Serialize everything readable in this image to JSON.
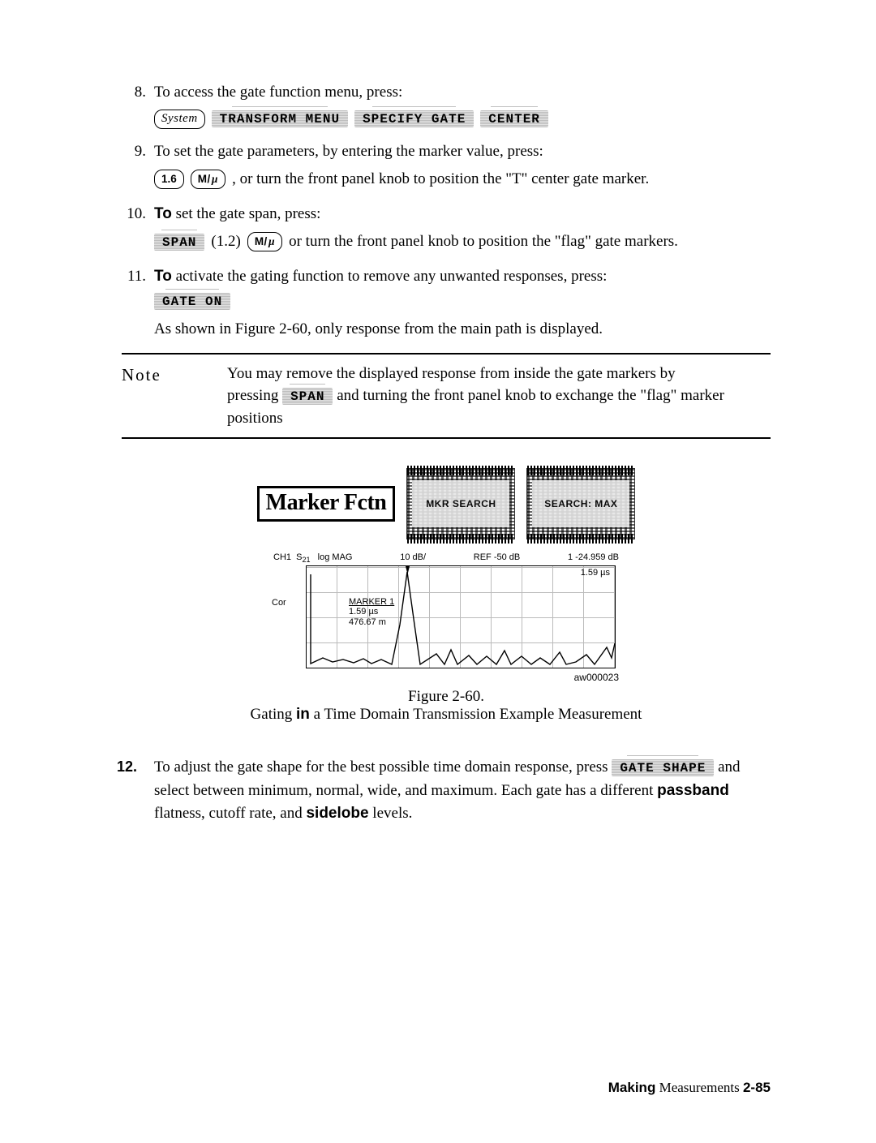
{
  "steps": {
    "s8": {
      "num": "8.",
      "text": "To   access the gate function menu, press:",
      "keys": {
        "system": "System",
        "transform": "TRANSFORM MENU",
        "specify": "SPECIFY GATE",
        "center": "CENTER"
      }
    },
    "s9": {
      "num": "9.",
      "text": "To set the gate parameters, by entering the marker value, press:",
      "val": "1.6",
      "unit": "M/µ",
      "tail_a": ", or turn the front panel knob to position the ",
      "tail_q1": "\"",
      "tail_t": "T",
      "tail_q2": "\"",
      "tail_b": " center gate marker."
    },
    "s10": {
      "num": "10.",
      "lead": "To",
      "text": " set the gate span, press:",
      "span": "SPAN",
      "val": "(1.2)",
      "unit": "M/µ",
      "tail": " or turn the front panel knob to position the \"flag\" gate markers."
    },
    "s11": {
      "num": "11.",
      "lead": "To",
      "text": " activate the gating function to remove any unwanted responses, press:",
      "gate_on": "GATE ON",
      "after": "As shown in Figure 2-60, only response from the main path is displayed."
    }
  },
  "note": {
    "label": "Note",
    "line1_a": "You may remove the displayed response from inside the gate markers by",
    "line2_a": "pressing ",
    "span": "SPAN",
    "line2_b": " and turning the front panel knob to exchange the \"flag\" marker",
    "line3": "positions"
  },
  "figure": {
    "marker_fctn": "Marker Fctn",
    "barcode_a": "MKR SEARCH",
    "barcode_b": "SEARCH: MAX",
    "header": {
      "ch": "CH1",
      "s21": "S",
      "s21sub": "21",
      "log": "log MAG",
      "scale": "10 dB/",
      "ref": "REF -50 dB",
      "mkr_r": "1  -24.959 dB",
      "mkr_r2": "1.59 µs"
    },
    "cor": "Cor",
    "mkr1_a": "MARKER 1",
    "mkr1_b": "1.59 µs",
    "mkr1_c": "476.67 m",
    "aw": "aw000023",
    "caption_num": "Figure 2-60.",
    "caption_text_a": "Gating ",
    "caption_bold": "in",
    "caption_text_b": " a Time Domain Transmission Example Measurement"
  },
  "step12": {
    "num": "12.",
    "a": "To adjust the gate shape for the best possible time domain response, press ",
    "gate_shape": "GATE SHAPE",
    "b": " and select between minimum, normal, wide, and maximum. Each gate has a different ",
    "passband": "passband",
    "c": " flatness, cutoff rate, and ",
    "sidelobe": "sidelobe",
    "d": " levels."
  },
  "footer": {
    "bold": "Making",
    "rest": " Measurements ",
    "page": "2-85"
  }
}
